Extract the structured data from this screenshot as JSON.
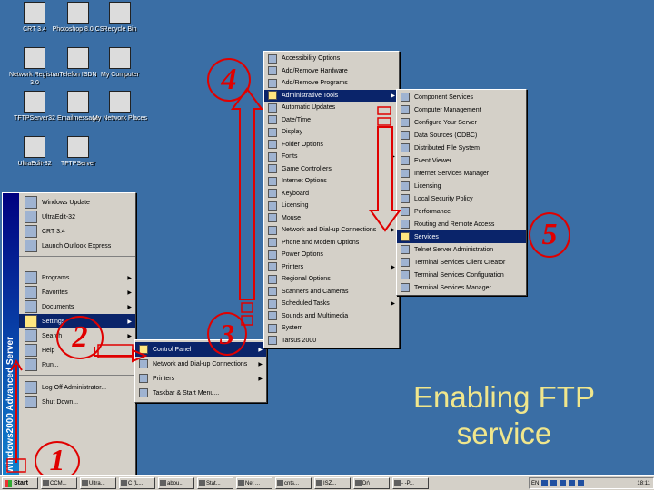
{
  "desktop": {
    "icons": [
      {
        "label": "CRT 3.4",
        "icon": "computer-icon"
      },
      {
        "label": "Photoshop 8.0 CS",
        "icon": "photoshop-icon"
      },
      {
        "label": "Recycle Bin",
        "icon": "recycle-bin-icon"
      },
      {
        "label": "Network Registrar 3.0",
        "icon": "network-icon"
      },
      {
        "label": "Telefon ISDN",
        "icon": "document-icon"
      },
      {
        "label": "My Computer",
        "icon": "my-computer-icon"
      },
      {
        "label": "TFTPServer32",
        "icon": "tftp-icon"
      },
      {
        "label": "Emailmessage",
        "icon": "email-icon"
      },
      {
        "label": "My Network Places",
        "icon": "network-places-icon"
      },
      {
        "label": "UltraEdit-32",
        "icon": "ultraedit-icon"
      },
      {
        "label": "TFTPServer",
        "icon": "document-icon"
      }
    ]
  },
  "start_menu": {
    "banner": "Windows2000 Advanced Server",
    "top_items": [
      "Windows Update",
      "UltraEdit-32",
      "CRT 3.4",
      "Launch Outlook Express"
    ],
    "items": [
      {
        "label": "Programs",
        "submenu": true
      },
      {
        "label": "Favorites",
        "submenu": true
      },
      {
        "label": "Documents",
        "submenu": true
      },
      {
        "label": "Settings",
        "submenu": true,
        "selected": true
      },
      {
        "label": "Search",
        "submenu": true
      },
      {
        "label": "Help",
        "submenu": false
      },
      {
        "label": "Run...",
        "submenu": false
      }
    ],
    "bottom_items": [
      "Log Off Administrator...",
      "Shut Down..."
    ]
  },
  "settings_menu": {
    "items": [
      {
        "label": "Control Panel",
        "submenu": true,
        "selected": true
      },
      {
        "label": "Network and Dial-up Connections",
        "submenu": true
      },
      {
        "label": "Printers",
        "submenu": true
      },
      {
        "label": "Taskbar & Start Menu...",
        "submenu": false
      }
    ]
  },
  "control_panel_menu": {
    "items": [
      {
        "label": "Accessibility Options",
        "submenu": false
      },
      {
        "label": "Add/Remove Hardware",
        "submenu": false
      },
      {
        "label": "Add/Remove Programs",
        "submenu": false
      },
      {
        "label": "Administrative Tools",
        "submenu": true,
        "selected": true
      },
      {
        "label": "Automatic Updates",
        "submenu": false
      },
      {
        "label": "Date/Time",
        "submenu": false
      },
      {
        "label": "Display",
        "submenu": false
      },
      {
        "label": "Folder Options",
        "submenu": false
      },
      {
        "label": "Fonts",
        "submenu": true
      },
      {
        "label": "Game Controllers",
        "submenu": false
      },
      {
        "label": "Internet Options",
        "submenu": false
      },
      {
        "label": "Keyboard",
        "submenu": false
      },
      {
        "label": "Licensing",
        "submenu": false
      },
      {
        "label": "Mouse",
        "submenu": false
      },
      {
        "label": "Network and Dial-up Connections",
        "submenu": true
      },
      {
        "label": "Phone and Modem Options",
        "submenu": false
      },
      {
        "label": "Power Options",
        "submenu": false
      },
      {
        "label": "Printers",
        "submenu": true
      },
      {
        "label": "Regional Options",
        "submenu": false
      },
      {
        "label": "Scanners and Cameras",
        "submenu": false
      },
      {
        "label": "Scheduled Tasks",
        "submenu": true
      },
      {
        "label": "Sounds and Multimedia",
        "submenu": false
      },
      {
        "label": "System",
        "submenu": false
      },
      {
        "label": "Tarsus 2000",
        "submenu": false
      }
    ]
  },
  "admin_tools_menu": {
    "items": [
      {
        "label": "Component Services",
        "selected": false
      },
      {
        "label": "Computer Management",
        "selected": false
      },
      {
        "label": "Configure Your Server",
        "selected": false
      },
      {
        "label": "Data Sources (ODBC)",
        "selected": false
      },
      {
        "label": "Distributed File System",
        "selected": false
      },
      {
        "label": "Event Viewer",
        "selected": false
      },
      {
        "label": "Internet Services Manager",
        "selected": false
      },
      {
        "label": "Licensing",
        "selected": false
      },
      {
        "label": "Local Security Policy",
        "selected": false
      },
      {
        "label": "Performance",
        "selected": false
      },
      {
        "label": "Routing and Remote Access",
        "selected": false
      },
      {
        "label": "Services",
        "selected": true
      },
      {
        "label": "Telnet Server Administration",
        "selected": false
      },
      {
        "label": "Terminal Services Client Creator",
        "selected": false
      },
      {
        "label": "Terminal Services Configuration",
        "selected": false
      },
      {
        "label": "Terminal Services Manager",
        "selected": false
      }
    ]
  },
  "taskbar": {
    "start_label": "Start",
    "tasks": [
      "CCM...",
      "Ultra...",
      "C (L...",
      "abou...",
      "Stat...",
      "Net ...",
      "cnts...",
      "ISZ...",
      "Dr\\",
      "- -P..."
    ],
    "tray_label": "EN",
    "clock": "18:11"
  },
  "annotations": {
    "steps": [
      "1",
      "2",
      "3",
      "4",
      "5"
    ]
  },
  "caption": {
    "line1": "Enabling FTP",
    "line2": "service"
  }
}
